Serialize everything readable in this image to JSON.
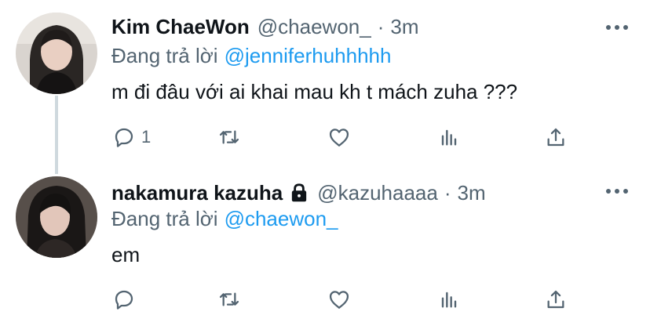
{
  "tweets": [
    {
      "display_name": "Kim ChaeWon",
      "handle": "@chaewon_",
      "separator": "·",
      "time": "3m",
      "reply_prefix": "Đang trả lời",
      "reply_to": "@jenniferhuhhhhh",
      "text": "m đi đâu với ai khai mau kh t mách zuha ???",
      "reply_count": "1",
      "protected": false
    },
    {
      "display_name": "nakamura kazuha",
      "handle": "@kazuhaaaa",
      "separator": "·",
      "time": "3m",
      "reply_prefix": "Đang trả lời",
      "reply_to": "@chaewon_",
      "text": "em",
      "reply_count": "",
      "protected": true
    }
  ],
  "icons": {
    "reply": "reply-bubble-icon",
    "retweet": "retweet-icon",
    "like": "heart-icon",
    "stats": "bar-chart-icon",
    "share": "share-upload-icon",
    "more": "more-dots-icon",
    "lock": "lock-icon"
  },
  "colors": {
    "link": "#1d9bf0",
    "secondary_text": "#536471",
    "primary_text": "#0f1419",
    "thread_line": "#cfd9de"
  }
}
